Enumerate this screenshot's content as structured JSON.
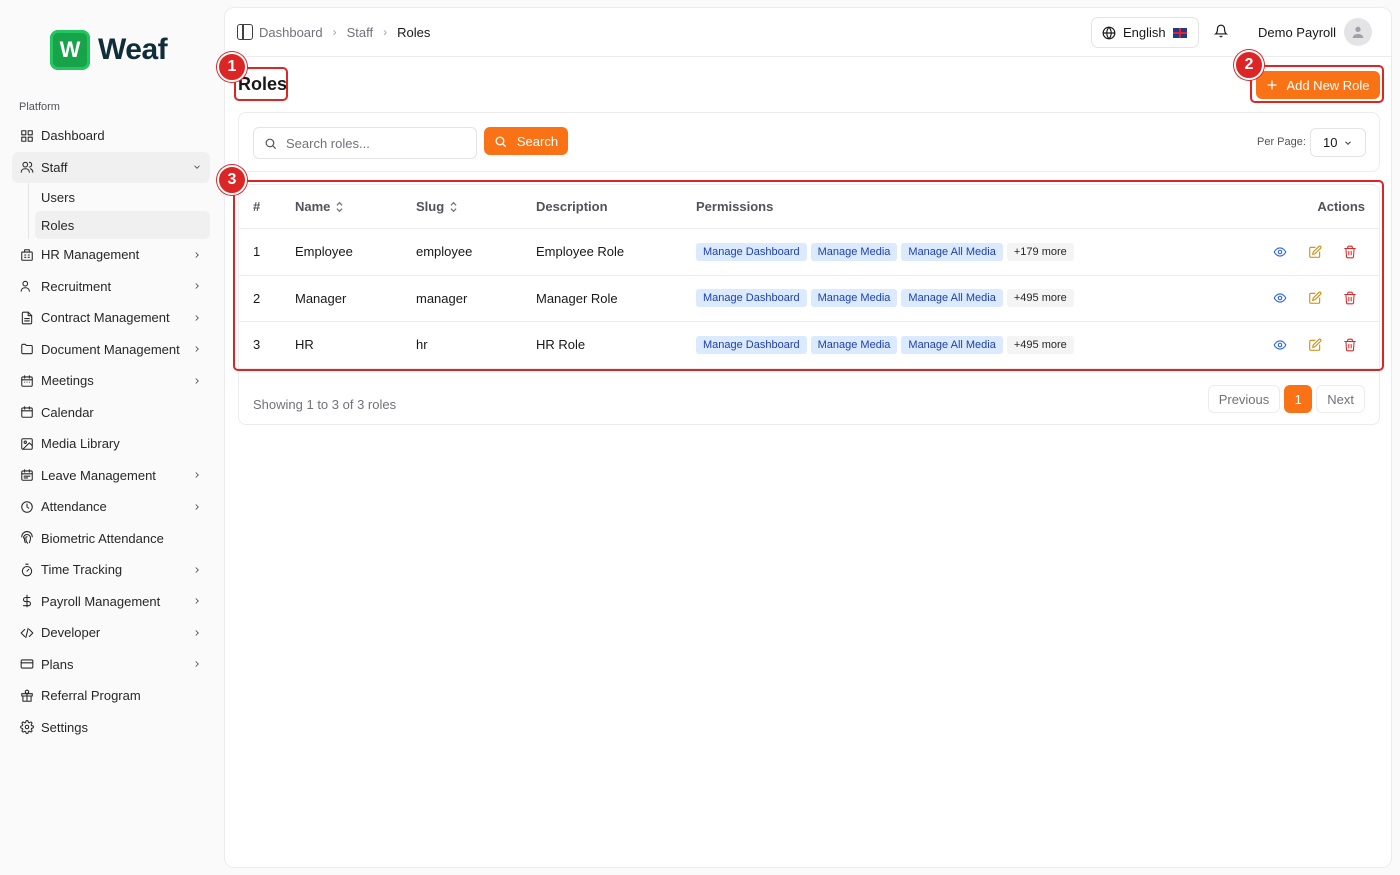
{
  "brand": {
    "logo_letter": "W",
    "name": "Weaf",
    "color": "#16a34a"
  },
  "sidebar": {
    "section_label": "Platform",
    "items": [
      {
        "label": "Dashboard",
        "icon": "grid-icon",
        "chevron": false
      },
      {
        "label": "Staff",
        "icon": "users-icon",
        "chevron": "down",
        "children": [
          {
            "label": "Users"
          },
          {
            "label": "Roles"
          }
        ]
      },
      {
        "label": "HR Management",
        "icon": "building-icon",
        "chevron": "right"
      },
      {
        "label": "Recruitment",
        "icon": "user-plus-icon",
        "chevron": "right"
      },
      {
        "label": "Contract Management",
        "icon": "file-text-icon",
        "chevron": "right"
      },
      {
        "label": "Document Management",
        "icon": "folder-icon",
        "chevron": "right"
      },
      {
        "label": "Meetings",
        "icon": "calendar-days-icon",
        "chevron": "right"
      },
      {
        "label": "Calendar",
        "icon": "calendar-icon",
        "chevron": false
      },
      {
        "label": "Media Library",
        "icon": "image-icon",
        "chevron": false
      },
      {
        "label": "Leave Management",
        "icon": "calendar-check-icon",
        "chevron": "right"
      },
      {
        "label": "Attendance",
        "icon": "clock-icon",
        "chevron": "right"
      },
      {
        "label": "Biometric Attendance",
        "icon": "fingerprint-icon",
        "chevron": false
      },
      {
        "label": "Time Tracking",
        "icon": "timer-icon",
        "chevron": "right"
      },
      {
        "label": "Payroll Management",
        "icon": "dollar-icon",
        "chevron": "right"
      },
      {
        "label": "Developer",
        "icon": "code-icon",
        "chevron": "right"
      },
      {
        "label": "Plans",
        "icon": "credit-card-icon",
        "chevron": "right"
      },
      {
        "label": "Referral Program",
        "icon": "gift-icon",
        "chevron": false
      },
      {
        "label": "Settings",
        "icon": "gear-icon",
        "chevron": false
      }
    ]
  },
  "header": {
    "breadcrumbs": [
      "Dashboard",
      "Staff",
      "Roles"
    ],
    "language": "English",
    "user_name": "Demo Payroll"
  },
  "page": {
    "title": "Roles",
    "add_button": "Add New Role",
    "search_placeholder": "Search roles...",
    "search_button": "Search",
    "per_page_label": "Per Page:",
    "per_page_value": "10"
  },
  "table": {
    "columns": [
      "#",
      "Name",
      "Slug",
      "Description",
      "Permissions",
      "Actions"
    ],
    "rows": [
      {
        "num": "1",
        "name": "Employee",
        "slug": "employee",
        "description": "Employee Role",
        "permissions": [
          "Manage Dashboard",
          "Manage Media",
          "Manage All Media"
        ],
        "more": "+179 more"
      },
      {
        "num": "2",
        "name": "Manager",
        "slug": "manager",
        "description": "Manager Role",
        "permissions": [
          "Manage Dashboard",
          "Manage Media",
          "Manage All Media"
        ],
        "more": "+495 more"
      },
      {
        "num": "3",
        "name": "HR",
        "slug": "hr",
        "description": "HR Role",
        "permissions": [
          "Manage Dashboard",
          "Manage Media",
          "Manage All Media"
        ],
        "more": "+495 more"
      }
    ]
  },
  "pagination": {
    "summary": "Showing 1 to 3 of 3 roles",
    "previous": "Previous",
    "current": "1",
    "next": "Next"
  },
  "annotations": [
    "1",
    "2",
    "3"
  ],
  "colors": {
    "accent": "#f97316",
    "annotation": "#dc2626",
    "tag_bg": "#dbeafe",
    "tag_text": "#1e40af"
  }
}
